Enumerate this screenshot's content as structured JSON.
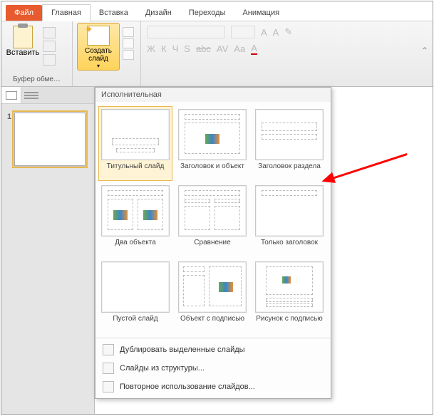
{
  "tabs": {
    "file": "Файл",
    "items": [
      "Главная",
      "Вставка",
      "Дизайн",
      "Переходы",
      "Анимация"
    ]
  },
  "ribbon": {
    "clipboard_label": "Буфер обме…",
    "paste_label": "Вставить",
    "newslide_label": "Создать слайд",
    "font_ghost": {
      "b": "Ж",
      "i": "К",
      "u": "Ч",
      "s": "S",
      "strike": "abc",
      "spacing": "AV",
      "case": "Aa",
      "a_up": "A",
      "a_dn": "A"
    }
  },
  "dropdown": {
    "header": "Исполнительная",
    "layouts": [
      {
        "label": "Титульный слайд",
        "type": "title",
        "selected": true
      },
      {
        "label": "Заголовок и объект",
        "type": "content"
      },
      {
        "label": "Заголовок раздела",
        "type": "section"
      },
      {
        "label": "Два объекта",
        "type": "two"
      },
      {
        "label": "Сравнение",
        "type": "compare"
      },
      {
        "label": "Только заголовок",
        "type": "only-title"
      },
      {
        "label": "Пустой слайд",
        "type": "blank"
      },
      {
        "label": "Объект с подписью",
        "type": "caption"
      },
      {
        "label": "Рисунок с подписью",
        "type": "picture"
      }
    ],
    "commands": [
      "Дублировать выделенные слайды",
      "Слайды из структуры...",
      "Повторное использование слайдов..."
    ]
  },
  "workspace": {
    "slide_number": "1"
  }
}
